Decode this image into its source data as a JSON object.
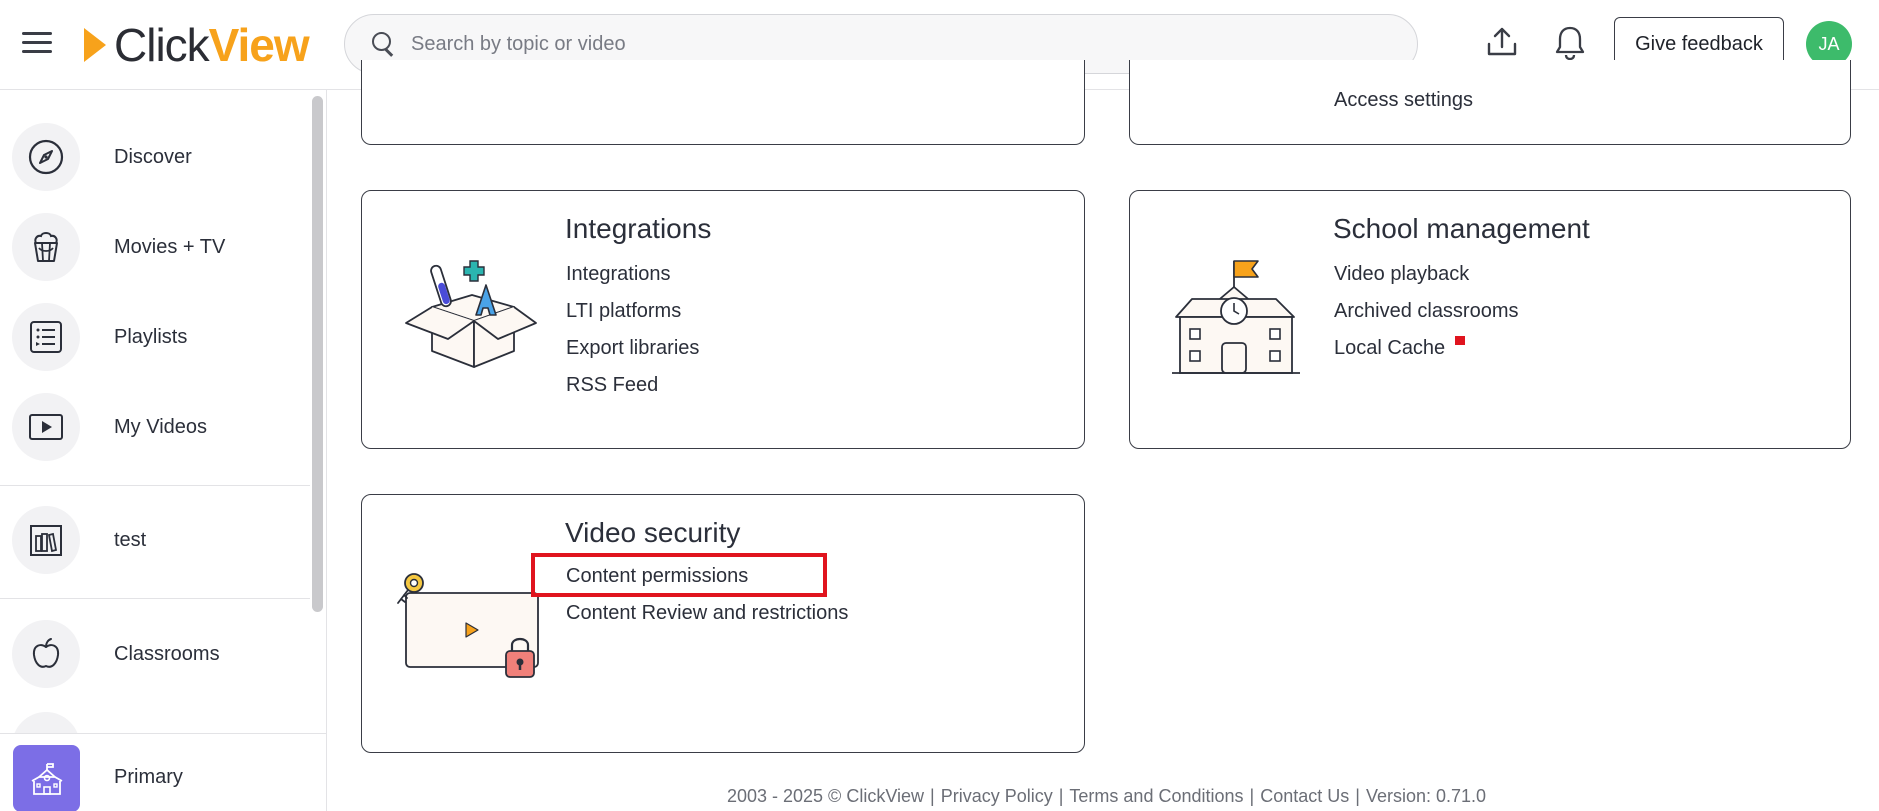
{
  "app": {
    "logo_click": "Click",
    "logo_view": "View",
    "brand_color": "#f7a21b"
  },
  "header": {
    "search_placeholder": "Search by topic or video",
    "feedback_label": "Give feedback",
    "avatar_initials": "JA",
    "avatar_color": "#3dbb6b",
    "icons": [
      "menu-icon",
      "search-icon",
      "upload-icon",
      "bell-icon"
    ]
  },
  "sidebar": {
    "items": [
      {
        "label": "Discover",
        "icon": "compass-icon"
      },
      {
        "label": "Movies + TV",
        "icon": "popcorn-icon"
      },
      {
        "label": "Playlists",
        "icon": "list-icon"
      },
      {
        "label": "My Videos",
        "icon": "play-square-icon"
      },
      {
        "label": "test",
        "icon": "library-icon"
      },
      {
        "label": "Classrooms",
        "icon": "apple-icon"
      }
    ],
    "bottom": {
      "label": "Primary",
      "icon": "school-icon",
      "badge_color": "#7c6ee6"
    }
  },
  "cards": {
    "top_right_partial": {
      "links": [
        "Access settings"
      ]
    },
    "integrations": {
      "title": "Integrations",
      "links": [
        "Integrations",
        "LTI platforms",
        "Export libraries",
        "RSS Feed"
      ]
    },
    "school_management": {
      "title": "School management",
      "links": [
        "Video playback",
        "Archived classrooms",
        "Local Cache"
      ]
    },
    "video_security": {
      "title": "Video security",
      "links": [
        "Content permissions",
        "Content Review and restrictions"
      ],
      "highlighted_link": "Content permissions",
      "highlight_color": "#e0141e"
    }
  },
  "footer": {
    "copyright": "2003 - 2025 © ClickView",
    "privacy": "Privacy Policy",
    "terms": "Terms and Conditions",
    "contact": "Contact Us",
    "version": "Version: 0.71.0",
    "separator": "|"
  }
}
